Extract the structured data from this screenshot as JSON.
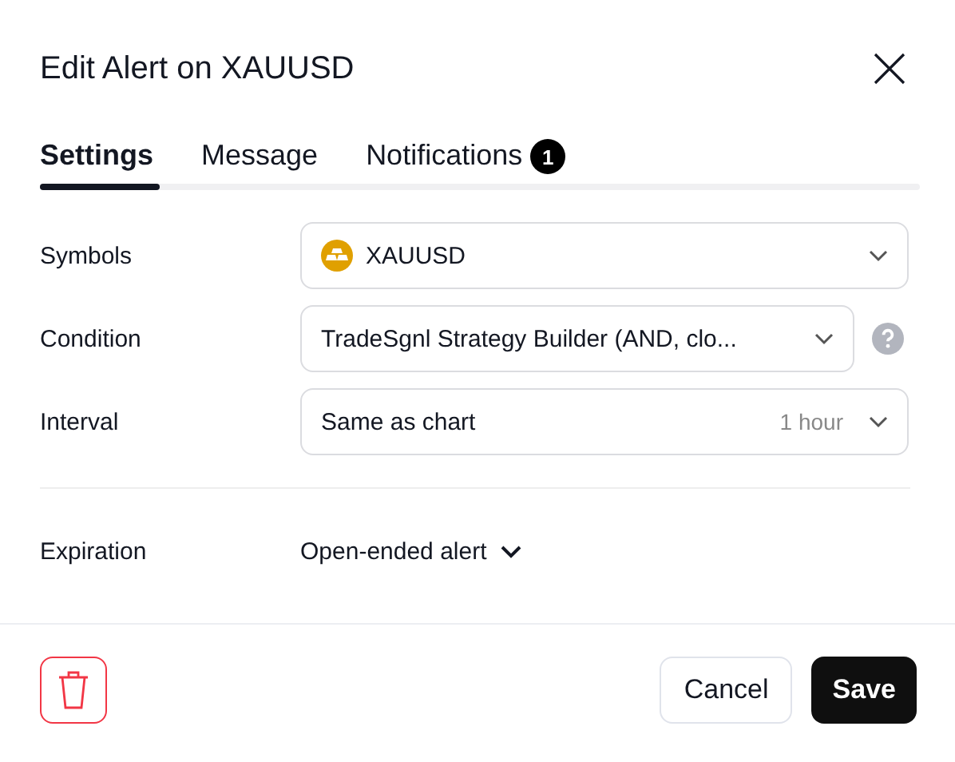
{
  "dialog": {
    "title": "Edit Alert on XAUUSD"
  },
  "tabs": [
    {
      "label": "Settings",
      "selected": true
    },
    {
      "label": "Message",
      "selected": false
    },
    {
      "label": "Notifications",
      "selected": false,
      "badge": "1"
    }
  ],
  "fields": [
    {
      "label": "Symbols",
      "value": "XAUUSD",
      "symbol_icon": true,
      "help": false
    },
    {
      "label": "Condition",
      "value": "TradeSgnl Strategy Builder (AND, clo...",
      "symbol_icon": false,
      "help": true
    },
    {
      "label": "Interval",
      "value": "Same as chart",
      "hint": "1 hour",
      "symbol_icon": false,
      "help": false
    }
  ],
  "expiration": {
    "label": "Expiration",
    "value": "Open-ended alert"
  },
  "buttons": {
    "cancel": "Cancel",
    "save": "Save"
  }
}
